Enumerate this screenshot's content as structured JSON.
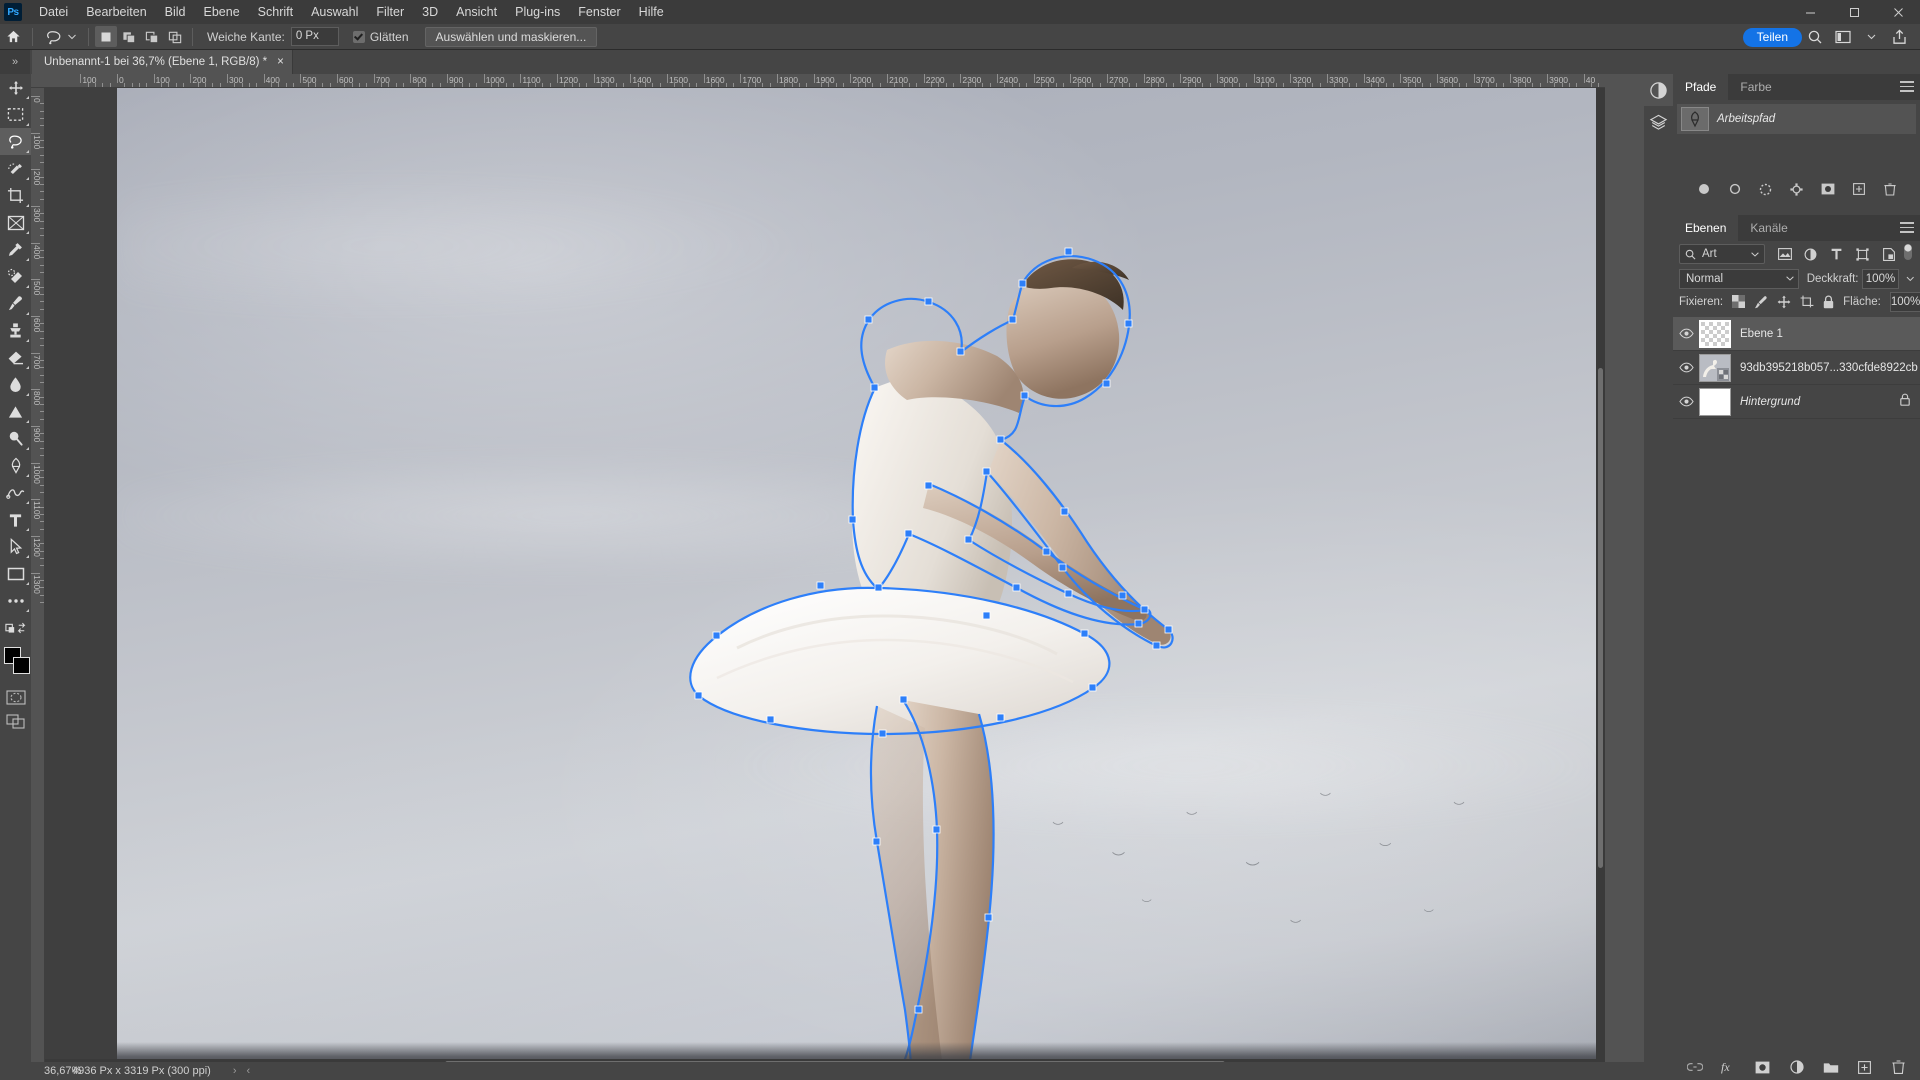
{
  "app": {
    "logo": "Ps",
    "menus": [
      "Datei",
      "Bearbeiten",
      "Bild",
      "Ebene",
      "Schrift",
      "Auswahl",
      "Filter",
      "3D",
      "Ansicht",
      "Plug-ins",
      "Fenster",
      "Hilfe"
    ],
    "window_controls": [
      "minimize",
      "maximize",
      "close"
    ]
  },
  "options_bar": {
    "home_icon": "home-icon",
    "tool_icon": "lasso-tool-icon",
    "selection_modes": [
      "new-selection",
      "add-to-selection",
      "subtract-from-selection",
      "intersect-selection"
    ],
    "active_selection_mode": 0,
    "feather_label": "Weiche Kante:",
    "feather_value": "0 Px",
    "antialias_label": "Glätten",
    "antialias_checked": true,
    "select_mask_button": "Auswählen und maskieren...",
    "share_button": "Teilen",
    "right_icons": [
      "search-icon",
      "workspace-icon",
      "chevron-down-icon",
      "share-export-icon"
    ]
  },
  "document_tab": {
    "expander": "»",
    "title": "Unbenannt-1 bei 36,7% (Ebene 1, RGB/8) *",
    "close": "×"
  },
  "toolbar": {
    "tools": [
      {
        "name": "move-tool",
        "active": false
      },
      {
        "name": "rectangular-marquee-tool",
        "active": false
      },
      {
        "name": "lasso-tool",
        "active": true
      },
      {
        "name": "quick-selection-tool",
        "active": false
      },
      {
        "name": "crop-tool",
        "active": false
      },
      {
        "name": "frame-tool",
        "active": false
      },
      {
        "name": "eyedropper-tool",
        "active": false
      },
      {
        "name": "spot-healing-brush-tool",
        "active": false
      },
      {
        "name": "brush-tool",
        "active": false
      },
      {
        "name": "clone-stamp-tool",
        "active": false
      },
      {
        "name": "eraser-tool",
        "active": false
      },
      {
        "name": "gradient-tool",
        "active": false
      },
      {
        "name": "dodge-tool",
        "active": false
      },
      {
        "name": "blur-tool",
        "active": false
      },
      {
        "name": "pen-tool",
        "active": false
      },
      {
        "name": "freeform-pen-tool",
        "active": false
      },
      {
        "name": "type-tool",
        "active": false
      },
      {
        "name": "path-selection-tool",
        "active": false
      },
      {
        "name": "rectangle-tool",
        "active": false
      },
      {
        "name": "more-tools",
        "active": false
      }
    ],
    "foreground_color": "#000000",
    "background_color": "#000000",
    "quick_mask": "quick-mask-icon",
    "screen_mode": "screen-mode-icon"
  },
  "rulers": {
    "unit": "Px",
    "h_ticks": [
      "100",
      "0",
      "100",
      "200",
      "300",
      "400",
      "500",
      "600",
      "700",
      "800",
      "900",
      "1000",
      "1100",
      "1200",
      "1300",
      "1400",
      "1500",
      "1600",
      "1700",
      "1800",
      "1900",
      "2000",
      "2100",
      "2200",
      "2300",
      "2400",
      "2500",
      "2600",
      "2700",
      "2800",
      "2900",
      "3000",
      "3100",
      "3200",
      "3300",
      "3400",
      "3500",
      "3600",
      "3700",
      "3800",
      "3900",
      "40"
    ],
    "v_ticks": [
      "100",
      "0",
      "100",
      "200",
      "300",
      "400",
      "500",
      "600",
      "700",
      "800",
      "900",
      "1000",
      "1100",
      "1200",
      "1300"
    ]
  },
  "canvas": {
    "selection_active": true,
    "selection_color": "#2d7ff9",
    "cursor": "mouse-pointer",
    "scrollbars": [
      "vertical-scrollbar",
      "horizontal-scrollbar"
    ]
  },
  "status_bar": {
    "zoom": "36,67%",
    "dimensions": "4936 Px x 3319 Px (300 ppi)",
    "arrow_right": "›",
    "arrow_left": "‹"
  },
  "icon_rail": [
    {
      "name": "adjustments-icon",
      "active": true
    },
    {
      "name": "layers-stack-icon",
      "active": false
    }
  ],
  "paths_panel": {
    "tabs": [
      {
        "label": "Pfade",
        "active": true
      },
      {
        "label": "Farbe",
        "active": false
      }
    ],
    "menu_icon": "panel-menu-icon",
    "path_name": "Arbeitspfad",
    "path_thumb": "work-path-thumbnail",
    "footer_icons": [
      "fill-path-icon",
      "stroke-path-icon",
      "load-selection-icon",
      "make-work-path-icon",
      "add-mask-icon",
      "new-path-icon",
      "delete-path-icon"
    ]
  },
  "layers_panel": {
    "tabs": [
      {
        "label": "Ebenen",
        "active": true
      },
      {
        "label": "Kanäle",
        "active": false
      }
    ],
    "menu_icon": "panel-menu-icon",
    "filter": {
      "search_icon": "search-icon",
      "type_label": "Art",
      "chevron": "chevron-down-icon",
      "icons": [
        "filter-pixel-icon",
        "filter-adjustment-icon",
        "filter-type-icon",
        "filter-shape-icon",
        "filter-smart-object-icon"
      ],
      "toggle": "filter-toggle"
    },
    "blend_mode": "Normal",
    "opacity_label": "Deckkraft:",
    "opacity_value": "100%",
    "lock_label": "Fixieren:",
    "lock_icons": [
      "lock-transparency-icon",
      "lock-image-icon",
      "lock-position-icon",
      "lock-artboard-icon",
      "lock-all-icon"
    ],
    "fill_label": "Fläche:",
    "fill_value": "100%",
    "layers": [
      {
        "name": "Ebene 1",
        "visible": true,
        "selected": true,
        "thumb": "transparent-checker",
        "italic": false,
        "locked": false
      },
      {
        "name": "93db395218b057...330cfde8922cb",
        "visible": true,
        "selected": false,
        "thumb": "dancer-image",
        "italic": false,
        "locked": false
      },
      {
        "name": "Hintergrund",
        "visible": true,
        "selected": false,
        "thumb": "white-fill",
        "italic": true,
        "locked": true
      }
    ],
    "footer_icons": [
      "link-layers-icon",
      "layer-style-fx-icon",
      "add-layer-mask-icon",
      "new-adjustment-layer-icon",
      "new-group-icon",
      "new-layer-icon",
      "delete-layer-icon"
    ]
  }
}
